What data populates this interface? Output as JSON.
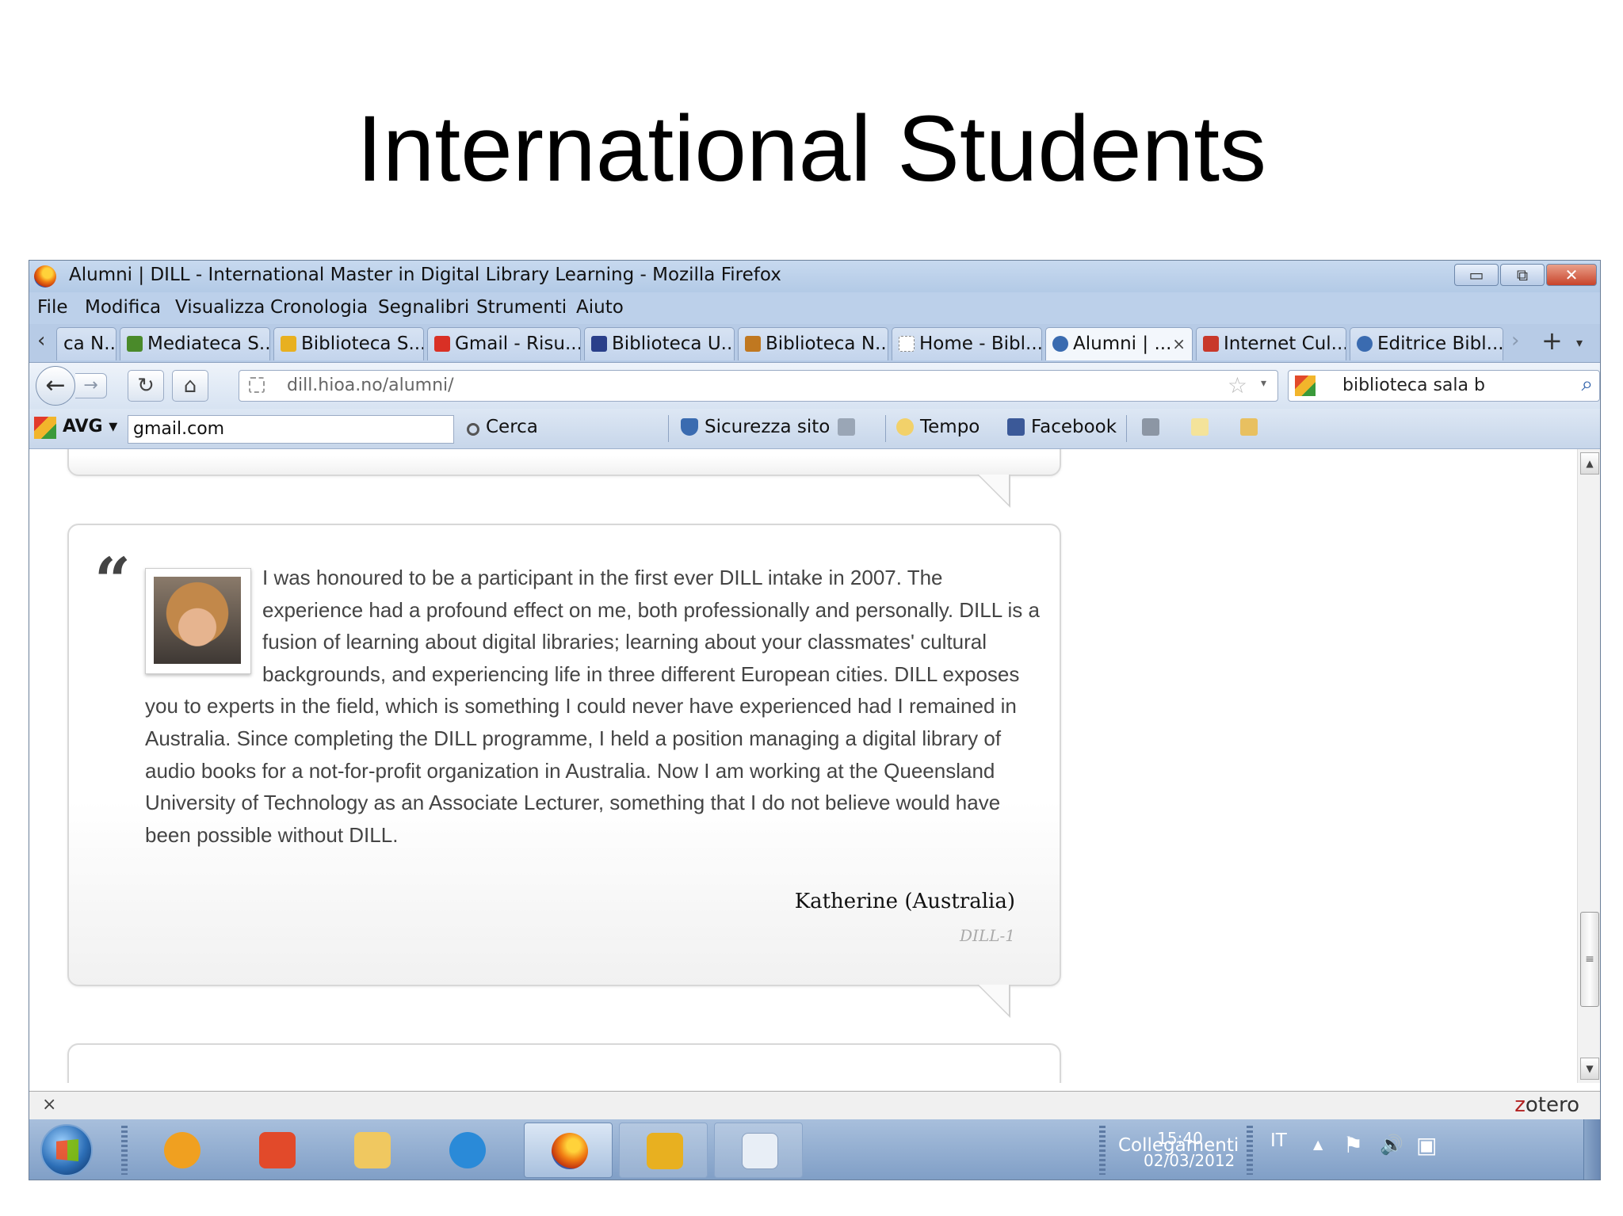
{
  "slide": {
    "title": "International Students"
  },
  "window": {
    "title": "Alumni | DILL - International Master in Digital Library Learning - Mozilla Firefox",
    "controls": {
      "minimize": "▭",
      "restore": "⧉",
      "close": "✕"
    }
  },
  "menu": [
    "File",
    "Modifica",
    "Visualizza",
    "Cronologia",
    "Segnalibri",
    "Strumenti",
    "Aiuto"
  ],
  "tabs": [
    {
      "label": "ca N...",
      "icon_color": "#d8d8d8"
    },
    {
      "label": "Mediateca S...",
      "icon_color": "#4a8a2a"
    },
    {
      "label": "Biblioteca S...",
      "icon_color": "#e8b020"
    },
    {
      "label": "Gmail - Risu...",
      "icon_color": "#d93025"
    },
    {
      "label": "Biblioteca U...",
      "icon_color": "#2a3f8a"
    },
    {
      "label": "Biblioteca N...",
      "icon_color": "#c07820"
    },
    {
      "label": "Home - Bibl...",
      "icon_color": "#dddddd"
    },
    {
      "label": "Alumni | ...",
      "icon_color": "#3a6bb0",
      "active": true
    },
    {
      "label": "Internet Cul...",
      "icon_color": "#c8382a"
    },
    {
      "label": "Editrice Bibl...",
      "icon_color": "#3a6bb0"
    }
  ],
  "tab_controls": {
    "scroll_left": "‹",
    "scroll_right": "›",
    "new_tab": "+",
    "list": "▾",
    "close_tab": "×"
  },
  "nav": {
    "back": "←",
    "forward": "→",
    "reload": "↻",
    "home": "⌂",
    "url": "dill.hioa.no/alumni/",
    "bookmark_star": "☆",
    "url_dropdown": "▾",
    "search_value": "biblioteca sala b",
    "search_go": "⌕"
  },
  "avg_toolbar": {
    "label": "AVG ▾",
    "search_value": "gmail.com",
    "search_button": "Cerca",
    "site_safety": "Sicurezza sito",
    "weather": "Tempo",
    "facebook": "Facebook"
  },
  "testimonial": {
    "quote_mark": "“",
    "text": "I was honoured to be a participant in the first ever DILL intake in 2007.  The experience had a profound effect on me, both professionally and personally. DILL is a fusion of learning about digital libraries; learning about your classmates' cultural backgrounds, and experiencing life in three different European cities. DILL exposes you to experts in the field, which is something I could never have experienced had I remained in Australia. Since completing the DILL programme, I held a position managing a digital library of audio books for a not-for-profit organization in Australia. Now I am working at the Queensland University of Technology as an Associate Lecturer, something that I do not believe would have been possible without DILL.",
    "author": "Katherine (Australia)",
    "cohort": "DILL-1"
  },
  "scrollbar": {
    "up": "▲",
    "down": "▼",
    "grip": "≡"
  },
  "statusbar": {
    "close": "×",
    "zotero_z": "z",
    "zotero_rest": "otero"
  },
  "taskbar": {
    "apps": [
      {
        "name": "media-player",
        "color": "#f0a020",
        "state": "none"
      },
      {
        "name": "presentation",
        "color": "#e24a2a",
        "state": "none"
      },
      {
        "name": "file-explorer",
        "color": "#f0c860",
        "state": "none"
      },
      {
        "name": "internet-explorer",
        "color": "#2a8ad8",
        "state": "none"
      },
      {
        "name": "firefox",
        "color": "#f07b12",
        "state": "active"
      },
      {
        "name": "application",
        "color": "#e8b020",
        "state": "open"
      },
      {
        "name": "odf-document",
        "color": "#e8eef6",
        "state": "open"
      }
    ],
    "links_label": "Collegamenti",
    "language": "IT",
    "tray_expand": "▲",
    "tray_flag": "⚑",
    "tray_volume": "🔊",
    "tray_network": "▣",
    "time": "15:40",
    "date": "02/03/2012"
  }
}
